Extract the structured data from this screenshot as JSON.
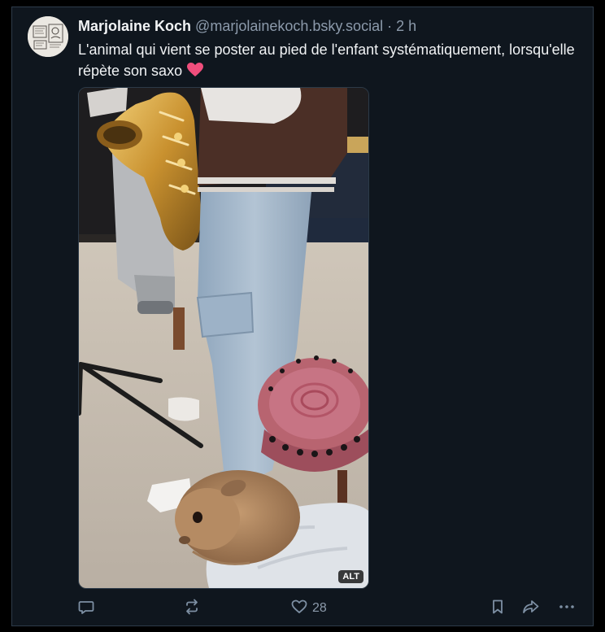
{
  "post": {
    "author_name": "Marjolaine Koch",
    "author_handle": "@marjolainekoch.bsky.social",
    "separator": "·",
    "time": "2 h",
    "text": "L'animal qui vient se poster au pied de l'enfant systématiquement, lorsqu'elle répète son saxo",
    "emoji": "heart-emoji",
    "image_alt_badge": "ALT",
    "like_count": "28"
  },
  "icons": {
    "reply": "speech-bubble-icon",
    "repost": "repost-arrows-icon",
    "like": "heart-outline-icon",
    "bookmark": "bookmark-icon",
    "share": "share-arrow-icon",
    "more": "more-dots-icon"
  },
  "colors": {
    "background": "#0f161e",
    "text": "#f1f3f5",
    "muted": "#8c9aab",
    "heart": "#f04e7c"
  }
}
